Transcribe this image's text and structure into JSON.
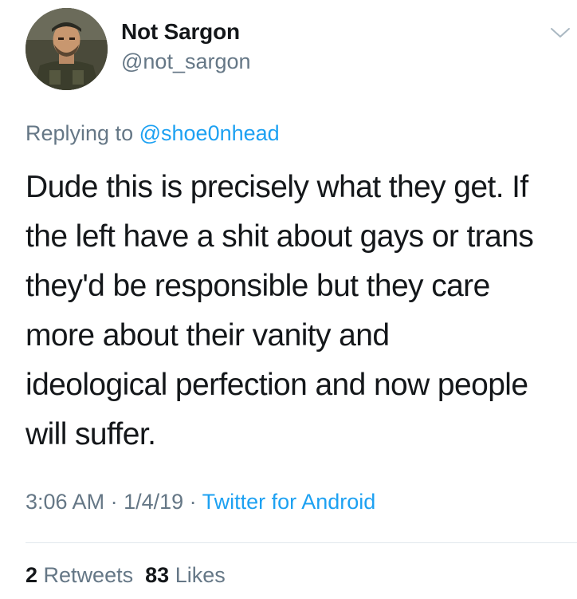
{
  "author": {
    "display_name": "Not Sargon",
    "handle": "@not_sargon",
    "avatar_icon": "soldier-avatar"
  },
  "reply": {
    "prefix": "Replying to",
    "handle": "@shoe0nhead"
  },
  "tweet": {
    "text": "Dude this is precisely what they get. If\nthe left have a shit about gays or trans\nthey'd be responsible but they care\nmore about their vanity and\nideological perfection and now people\nwill suffer."
  },
  "meta": {
    "time": "3:06 AM",
    "sep1": " · ",
    "date": "1/4/19",
    "sep2": " · ",
    "source": "Twitter for Android"
  },
  "stats": {
    "retweets_count": "2",
    "retweets_label": "Retweets",
    "likes_count": "83",
    "likes_label": "Likes"
  },
  "colors": {
    "text_primary": "#14171a",
    "text_secondary": "#657786",
    "link": "#1da1f2",
    "divider": "#e1e8ed"
  }
}
